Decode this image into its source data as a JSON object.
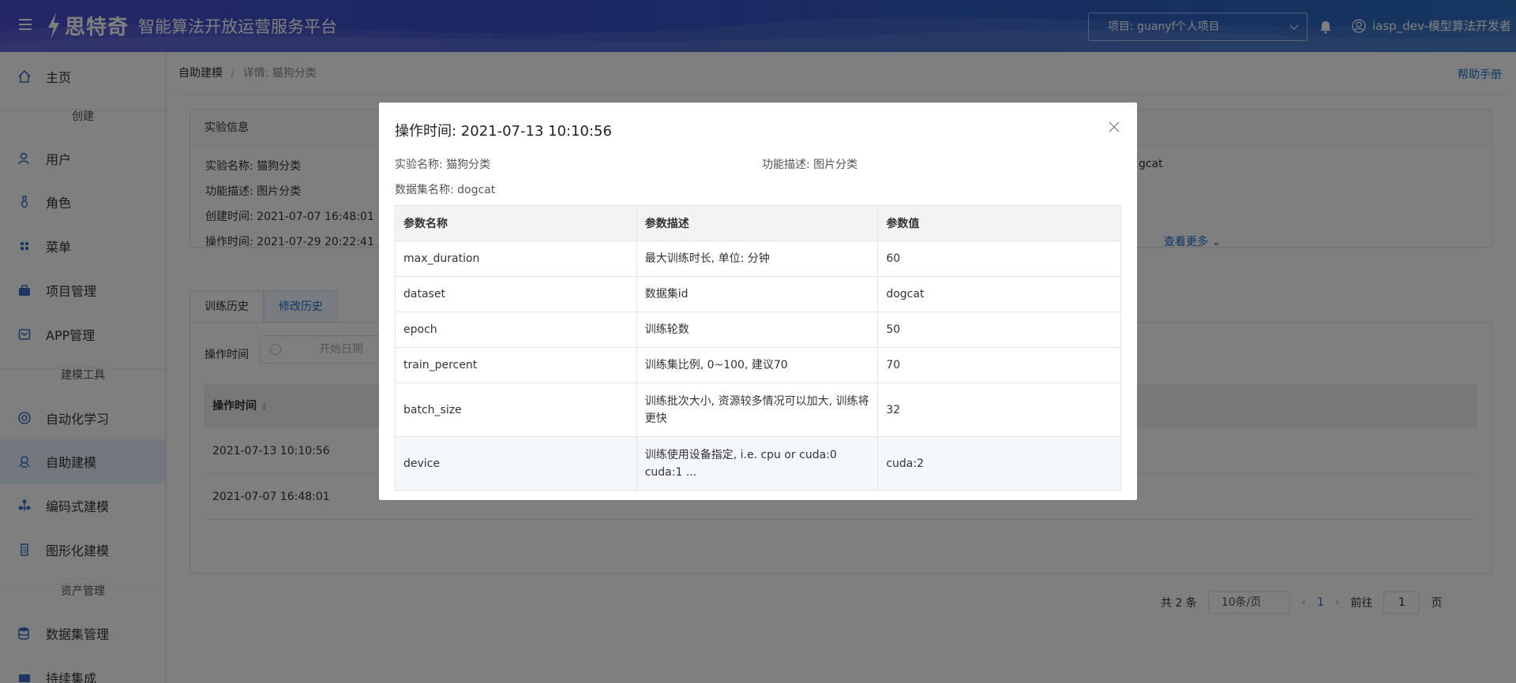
{
  "header": {
    "logo_name": "思特奇",
    "platform_title": "智能算法开放运营服务平台",
    "project_select": "项目: guanyf个人项目",
    "user_name": "iasp_dev-模型算法开发者"
  },
  "sidebar": {
    "items": [
      {
        "label": "主页",
        "icon": "home-icon"
      },
      {
        "label": "用户",
        "icon": "user-icon"
      },
      {
        "label": "角色",
        "icon": "role-icon"
      },
      {
        "label": "菜单",
        "icon": "menu-grid-icon"
      },
      {
        "label": "项目管理",
        "icon": "briefcase-icon"
      },
      {
        "label": "APP管理",
        "icon": "app-icon"
      },
      {
        "label": "自动化学习",
        "icon": "auto-learn-icon"
      },
      {
        "label": "自助建模",
        "icon": "self-model-icon"
      },
      {
        "label": "编码式建模",
        "icon": "code-model-icon"
      },
      {
        "label": "图形化建模",
        "icon": "graph-model-icon"
      },
      {
        "label": "数据集管理",
        "icon": "dataset-icon"
      },
      {
        "label": "持续集成",
        "icon": "ci-icon"
      }
    ],
    "groups": [
      "创建",
      "建模工具",
      "资产管理"
    ],
    "active_item": "自助建模"
  },
  "breadcrumb": {
    "root": "自助建模",
    "sep": "/",
    "current": "详情: 猫狗分类"
  },
  "help_link": "帮助手册",
  "exp_info": {
    "title": "实验信息",
    "name": "实验名称: 猫狗分类",
    "desc": "功能描述: 图片分类",
    "created": "创建时间: 2021-07-07 16:48:01",
    "operated": "操作时间: 2021-07-29 20:22:41",
    "dataset_partial": "gcat",
    "more": "查看更多"
  },
  "tabs": [
    {
      "label": "训练历史"
    },
    {
      "label": "修改历史"
    }
  ],
  "history": {
    "filter_label": "操作时间",
    "date_placeholder": "开始日期",
    "column": "操作时间",
    "rows": [
      "2021-07-13 10:10:56",
      "2021-07-07 16:48:01"
    ]
  },
  "pager": {
    "total": "共 2 条",
    "size": "10条/页",
    "page": "1",
    "goto_label": "前往",
    "goto_value": "1",
    "page_suffix": "页"
  },
  "modal": {
    "title": "操作时间: 2021-07-13 10:10:56",
    "exp_name": "实验名称: 猫狗分类",
    "func_desc": "功能描述: 图片分类",
    "dataset_name": "数据集名称: dogcat",
    "columns": [
      "参数名称",
      "参数描述",
      "参数值"
    ],
    "rows": [
      {
        "name": "max_duration",
        "desc": "最大训练时长, 单位: 分钟",
        "value": "60"
      },
      {
        "name": "dataset",
        "desc": "数据集id",
        "value": "dogcat"
      },
      {
        "name": "epoch",
        "desc": "训练轮数",
        "value": "50"
      },
      {
        "name": "train_percent",
        "desc": "训练集比例, 0~100, 建议70",
        "value": "70"
      },
      {
        "name": "batch_size",
        "desc": "训练批次大小, 资源较多情况可以加大, 训练将更快",
        "value": "32"
      },
      {
        "name": "device",
        "desc": "训练使用设备指定, i.e. cpu or cuda:0 cuda:1 ...",
        "value": "cuda:2"
      }
    ]
  },
  "colors": {
    "primary": "#1f6fd1",
    "header_start": "#4a4fd0",
    "header_end": "#2c6cc0",
    "active_bg": "#e6f0fc"
  }
}
